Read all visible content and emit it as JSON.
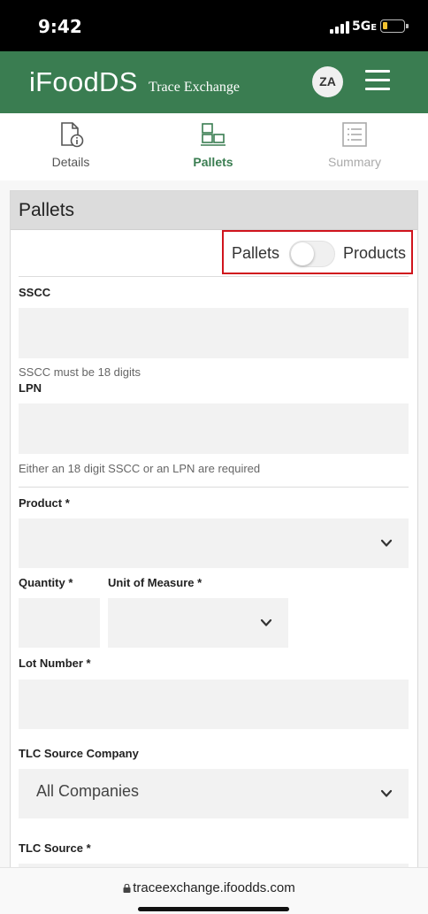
{
  "status_bar": {
    "time": "9:42",
    "network": "5G",
    "network_suffix": "E"
  },
  "header": {
    "logo": "iFoodDS",
    "subtitle": "Trace Exchange",
    "avatar_initials": "ZA",
    "brand_color": "#3a7d51"
  },
  "steps": [
    {
      "label": "Details",
      "icon": "document-info-icon",
      "state": "completed"
    },
    {
      "label": "Pallets",
      "icon": "pallets-icon",
      "state": "active"
    },
    {
      "label": "Summary",
      "icon": "summary-list-icon",
      "state": "disabled"
    }
  ],
  "card": {
    "title": "Pallets",
    "toggle": {
      "left_label": "Pallets",
      "right_label": "Products",
      "selected": "Pallets"
    }
  },
  "form": {
    "sscc": {
      "label": "SSCC",
      "value": "",
      "helper": "SSCC must be 18 digits"
    },
    "lpn": {
      "label": "LPN",
      "value": "",
      "helper": "Either an 18 digit SSCC or an LPN are required"
    },
    "product": {
      "label": "Product *",
      "value": ""
    },
    "quantity": {
      "label": "Quantity *",
      "value": ""
    },
    "unit_of_measure": {
      "label": "Unit of Measure *",
      "value": ""
    },
    "lot_number": {
      "label": "Lot Number *",
      "value": ""
    },
    "tlc_source_company": {
      "label": "TLC Source Company",
      "value": "All Companies"
    },
    "tlc_source": {
      "label": "TLC Source *",
      "value": ""
    }
  },
  "browser": {
    "url": "traceexchange.ifoodds.com"
  }
}
